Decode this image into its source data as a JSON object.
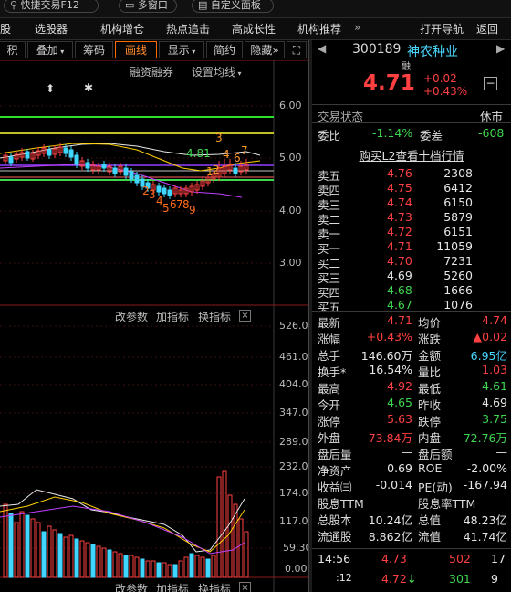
{
  "topbar": {
    "quick_trade": "快捷交易F12",
    "multi_window": "多窗口",
    "custom_panel": "自定义面板"
  },
  "menu": {
    "items": [
      "股",
      "选股器",
      "机构增仓",
      "热点追击",
      "高成长性",
      "机构推荐"
    ],
    "more": "»",
    "open_nav": "打开导航",
    "back": "返回"
  },
  "toolbar": {
    "items": [
      "积",
      "叠加",
      "筹码",
      "画线",
      "显示",
      "简约",
      "隐藏"
    ],
    "active": "画线",
    "more_icon": "»"
  },
  "kline": {
    "margin_label": "融资融券",
    "ma_setting": "设置均线",
    "price_ticks": [
      "6.00",
      "5.00",
      "4.00",
      "3.00"
    ],
    "annotations": [
      "4.81",
      "3",
      "4",
      "7",
      "1",
      "2",
      "6",
      "2",
      "3",
      "4",
      "5",
      "6",
      "7",
      "8",
      "9"
    ]
  },
  "volume": {
    "labels": [
      "改参数",
      "加指标",
      "换指标"
    ],
    "ticks": [
      "526.00",
      "461.00",
      "404.00",
      "347.00",
      "289.00",
      "232.00",
      "174.00",
      "117.00",
      "59.30",
      "0.00"
    ]
  },
  "indicator2": {
    "labels": [
      "改参数",
      "加指标",
      "换指标"
    ]
  },
  "stock": {
    "code": "300189",
    "name": "神农种业",
    "margin_tag": "融",
    "price": "4.71",
    "change": "+0.02",
    "change_pct": "+0.43%",
    "status_label": "交易状态",
    "status_value": "休市",
    "weibi_label": "委比",
    "weibi_value": "-1.14%",
    "weicha_label": "委差",
    "weicha_value": "-608",
    "l2_link": "购买L2查看十档行情"
  },
  "asks": [
    {
      "label": "卖五",
      "price": "4.76",
      "vol": "2308"
    },
    {
      "label": "卖四",
      "price": "4.75",
      "vol": "6412"
    },
    {
      "label": "卖三",
      "price": "4.74",
      "vol": "6150"
    },
    {
      "label": "卖二",
      "price": "4.73",
      "vol": "5879"
    },
    {
      "label": "卖一",
      "price": "4.72",
      "vol": "6151"
    }
  ],
  "bids": [
    {
      "label": "买一",
      "price": "4.71",
      "vol": "11059"
    },
    {
      "label": "买二",
      "price": "4.70",
      "vol": "7231"
    },
    {
      "label": "买三",
      "price": "4.69",
      "vol": "5260"
    },
    {
      "label": "买四",
      "price": "4.68",
      "vol": "1666"
    },
    {
      "label": "买五",
      "price": "4.67",
      "vol": "1076"
    }
  ],
  "stats": [
    {
      "l1": "最新",
      "v1": "4.71",
      "c1": "red",
      "l2": "均价",
      "v2": "4.74",
      "c2": "red"
    },
    {
      "l1": "涨幅",
      "v1": "+0.43%",
      "c1": "red",
      "l2": "涨跌",
      "v2": "▲0.02",
      "c2": "red"
    },
    {
      "l1": "总手",
      "v1": "146.60万",
      "c1": "white",
      "l2": "金额",
      "v2": "6.95亿",
      "c2": "cyan"
    },
    {
      "l1": "换手*",
      "v1": "16.54%",
      "c1": "white",
      "l2": "量比",
      "v2": "1.03",
      "c2": "red"
    },
    {
      "l1": "最高",
      "v1": "4.92",
      "c1": "red",
      "l2": "最低",
      "v2": "4.61",
      "c2": "green"
    },
    {
      "l1": "今开",
      "v1": "4.65",
      "c1": "green",
      "l2": "昨收",
      "v2": "4.69",
      "c2": "white"
    },
    {
      "l1": "涨停",
      "v1": "5.63",
      "c1": "red",
      "l2": "跌停",
      "v2": "3.75",
      "c2": "green"
    },
    {
      "l1": "外盘",
      "v1": "73.84万",
      "c1": "red",
      "l2": "内盘",
      "v2": "72.76万",
      "c2": "green"
    },
    {
      "l1": "盘后量",
      "v1": "—",
      "c1": "white",
      "l2": "盘后额",
      "v2": "—",
      "c2": "white"
    },
    {
      "l1": "净资产",
      "v1": "0.69",
      "c1": "white",
      "l2": "ROE",
      "v2": "-2.00%",
      "c2": "white"
    },
    {
      "l1": "收益㈢",
      "v1": "-0.014",
      "c1": "white",
      "l2": "PE(动)",
      "v2": "-167.94",
      "c2": "white"
    },
    {
      "l1": "股息TTM",
      "v1": "—",
      "c1": "white",
      "l2": "股息率TTM",
      "v2": "—",
      "c2": "white"
    },
    {
      "l1": "总股本",
      "v1": "10.24亿",
      "c1": "white",
      "l2": "总值",
      "v2": "48.23亿",
      "c2": "white"
    },
    {
      "l1": "流通股",
      "v1": "8.862亿",
      "c1": "white",
      "l2": "流值",
      "v2": "41.74亿",
      "c2": "white"
    }
  ],
  "ticks": [
    {
      "time": "14:56",
      "price": "4.73",
      "vol": "502",
      "n": "17",
      "pc": "red",
      "vc": "red",
      "arrow": ""
    },
    {
      "time": ":12",
      "price": "4.72",
      "vol": "301",
      "n": "9",
      "pc": "red",
      "vc": "green",
      "arrow": "↓"
    }
  ],
  "colors": {
    "up": "#ff4040",
    "down": "#3fd64f",
    "cyan": "#4ad8ff",
    "accent": "#ff6a00"
  }
}
